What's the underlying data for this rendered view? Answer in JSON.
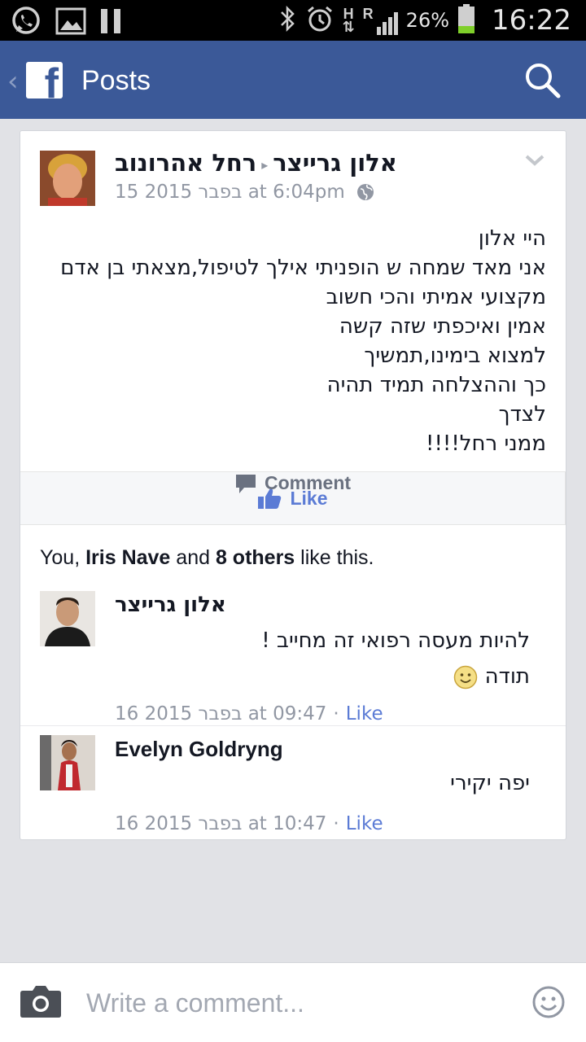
{
  "status_bar": {
    "battery_pct": "26%",
    "time": "16:22",
    "network_h": "H",
    "network_r": "R"
  },
  "header": {
    "title": "Posts"
  },
  "post": {
    "author": "רחל אהרונוב",
    "recipient": "אלון גרייצר",
    "timestamp": "15 בפבר 2015 at 6:04pm",
    "body_lines": [
      "היי אלון",
      "אני מאד שמחה ש הופניתי אילך לטיפול,מצאתי בן אדם",
      "מקצועי אמיתי והכי חשוב",
      "אמין ואיכפתי שזה קשה",
      "למצוא בימינו,תמשיך",
      "כך וההצלחה תמיד תהיה",
      "לצדך",
      "ממני רחל!!!!"
    ]
  },
  "actions": {
    "like_label": "Like",
    "comment_label": "Comment"
  },
  "likes_summary": {
    "prefix": "You, ",
    "name": "Iris Nave",
    "middle": " and ",
    "others": "8 others",
    "suffix": " like this."
  },
  "comments": [
    {
      "author": "אלון גרייצר",
      "lines": [
        "להיות מעסה רפואי זה מחייב !",
        "תודה"
      ],
      "timestamp": "16 בפבר 2015 at 09:47",
      "like_label": "Like"
    },
    {
      "author": "Evelyn Goldryng",
      "lines": [
        "יפה יקירי"
      ],
      "timestamp": "16 בפבר 2015 at 10:47",
      "like_label": "Like"
    }
  ],
  "composer": {
    "placeholder": "Write a comment..."
  },
  "colors": {
    "brand": "#3b5998",
    "link": "#5b7bd5",
    "meta": "#9197a3"
  }
}
